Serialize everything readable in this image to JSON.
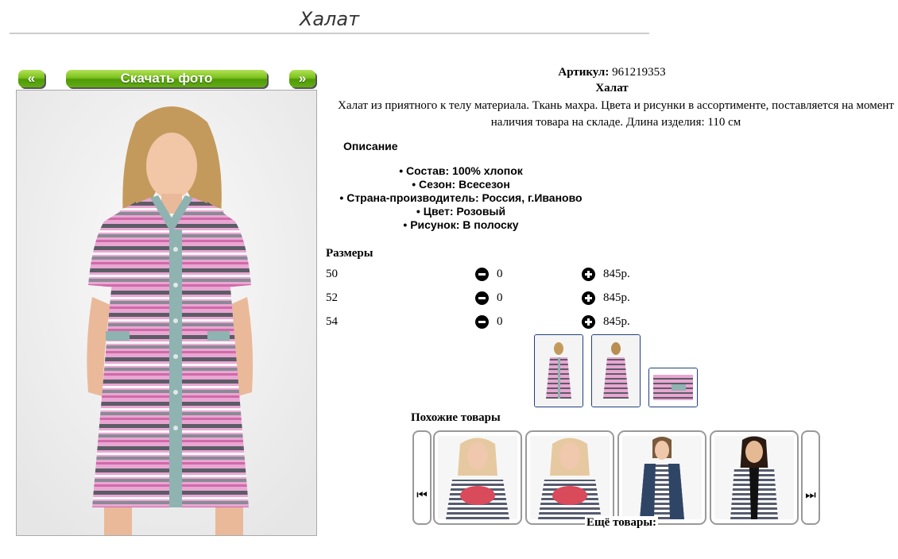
{
  "page": {
    "title": "Халат"
  },
  "buttons": {
    "prev": "«",
    "download": "Скачать фото",
    "next": "»"
  },
  "product": {
    "article_label": "Артикул:",
    "article_value": "961219353",
    "name": "Халат",
    "description": "Халат из приятного к телу материала. Ткань махра. Цвета и рисунки в ассортименте, поставляется на момент наличия товара на складе. Длина изделия: 110 см"
  },
  "specs": {
    "heading": "Описание",
    "items": [
      "Состав: 100% хлопок",
      "Сезон: Всесезон",
      "Страна-производитель: Россия, г.Иваново",
      "Цвет: Розовый",
      "Рисунок: В полоску"
    ]
  },
  "sizes": {
    "heading": "Размеры",
    "rows": [
      {
        "size": "50",
        "qty": "0",
        "price": "845р."
      },
      {
        "size": "52",
        "qty": "0",
        "price": "845р."
      },
      {
        "size": "54",
        "qty": "0",
        "price": "845р."
      }
    ]
  },
  "similar": {
    "heading": "Похожие товары",
    "more": "Ещё товары:"
  },
  "icons": {
    "minus": "minus-circle-icon",
    "plus": "plus-circle-icon",
    "carousel_prev": "skip-back-icon",
    "carousel_next": "skip-forward-icon"
  },
  "colors": {
    "button_green": "#6db516",
    "thumb_border": "#1f3f7a",
    "stripe_pink": "#e58ec6",
    "stripe_grey": "#5c5c66",
    "placket": "#8fb3b0"
  }
}
